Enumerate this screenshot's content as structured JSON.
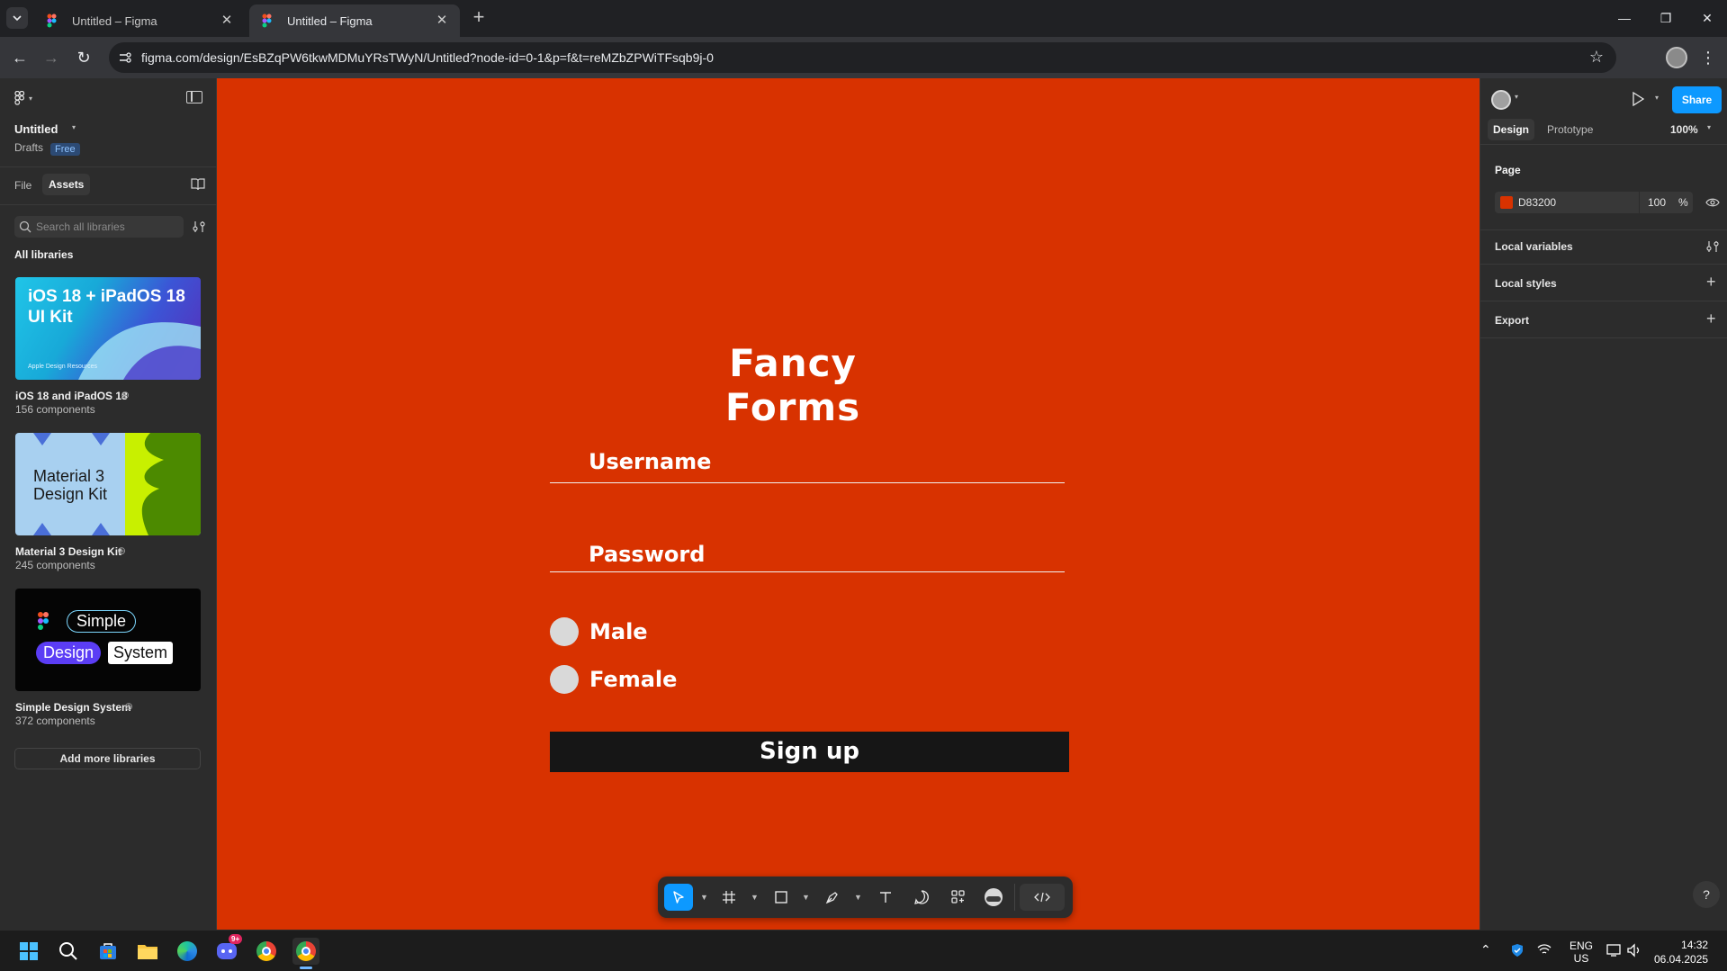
{
  "browser": {
    "tabs": [
      {
        "title": "Untitled – Figma",
        "active": false
      },
      {
        "title": "Untitled – Figma",
        "active": true
      }
    ],
    "url": "figma.com/design/EsBZqPW6tkwMDMuYRsTWyN/Untitled?node-id=0-1&p=f&t=reMZbZPWiTFsqb9j-0"
  },
  "left_panel": {
    "file_name": "Untitled",
    "location": "Drafts",
    "plan_badge": "Free",
    "tabs": [
      "File",
      "Assets"
    ],
    "active_tab": "Assets",
    "search_placeholder": "Search all libraries",
    "section_title": "All libraries",
    "libraries": [
      {
        "card_title": "iOS 18 + iPadOS 18 UI Kit",
        "card_footer": "Apple Design Resources",
        "name": "iOS 18 and iPadOS 18",
        "count": "156 components"
      },
      {
        "card_title_line1": "Material 3",
        "card_title_line2": "Design Kit",
        "name": "Material 3 Design Kit",
        "count": "245 components"
      },
      {
        "chip1": "Simple",
        "chip2": "Design",
        "chip3": "System",
        "name": "Simple Design System",
        "count": "372 components"
      }
    ],
    "add_more_label": "Add more libraries"
  },
  "canvas": {
    "background": "#D83200",
    "form_title": "Fancy Forms",
    "username_label": "Username",
    "password_label": "Password",
    "radio_male": "Male",
    "radio_female": "Female",
    "signup_label": "Sign up"
  },
  "right_panel": {
    "tabs": [
      "Design",
      "Prototype"
    ],
    "active_tab": "Design",
    "zoom": "100%",
    "share_label": "Share",
    "page_section": "Page",
    "page_color_hex": "D83200",
    "page_color": "#D83200",
    "page_opacity": "100",
    "page_opacity_unit": "%",
    "local_variables": "Local variables",
    "local_styles": "Local styles",
    "export": "Export",
    "help": "?"
  },
  "taskbar": {
    "notification_badge": "9+",
    "lang_line1": "ENG",
    "lang_line2": "US",
    "time": "14:32",
    "date": "06.04.2025"
  }
}
